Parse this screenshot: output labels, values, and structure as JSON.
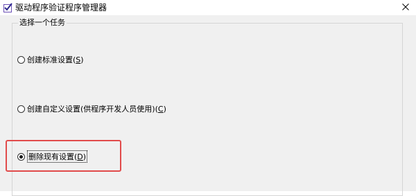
{
  "window": {
    "title": "驱动程序验证程序管理器",
    "icon": "verifier-app-icon",
    "close_glyph": "✕"
  },
  "task_group": {
    "legend": "选择一个任务",
    "options": [
      {
        "label": "创建标准设置(",
        "key": "S",
        "suffix": ")",
        "checked": false
      },
      {
        "label": "创建自定义设置(供程序开发人员使用)(",
        "key": "C",
        "suffix": ")",
        "checked": false
      },
      {
        "label": "删除现有设置(",
        "key": "D",
        "suffix": ")",
        "checked": true
      }
    ]
  },
  "colors": {
    "highlight": "#e14b4b",
    "background": "#f0f0f0"
  }
}
